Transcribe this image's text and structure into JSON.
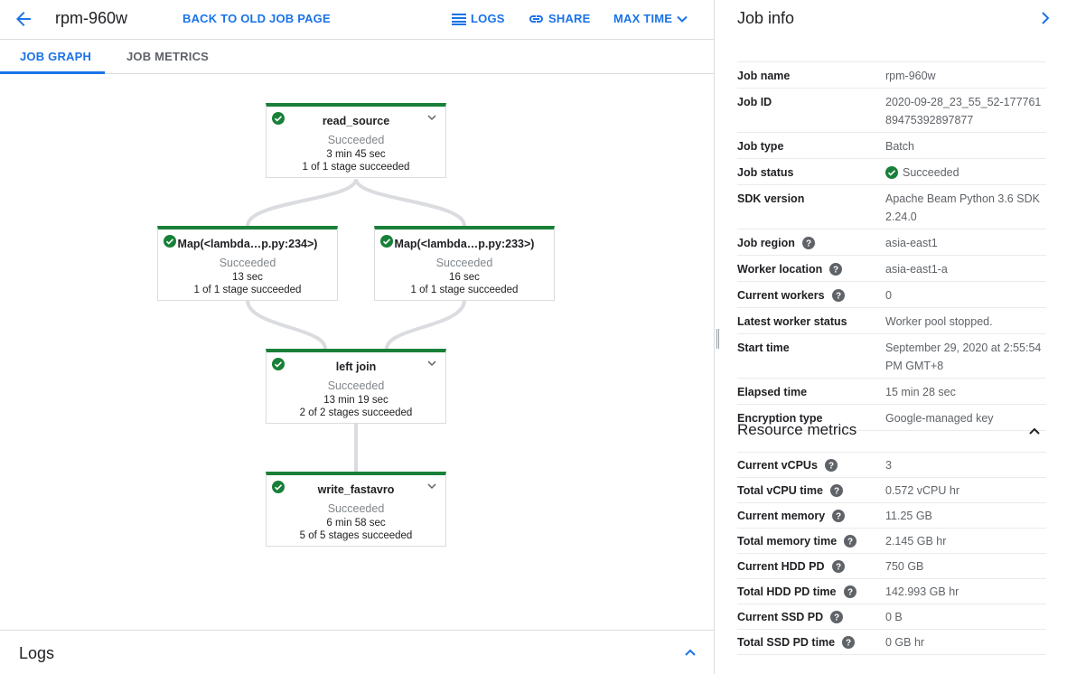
{
  "header": {
    "job_title": "rpm-960w",
    "back_old_label": "BACK TO OLD JOB PAGE",
    "logs_label": "LOGS",
    "share_label": "SHARE",
    "max_time_label": "MAX TIME"
  },
  "tabs": [
    {
      "label": "JOB GRAPH",
      "active": true
    },
    {
      "label": "JOB METRICS",
      "active": false
    }
  ],
  "graph": {
    "nodes": [
      {
        "name": "read_source",
        "status": "Succeeded",
        "duration": "3 min 45 sec",
        "stages": "1 of 1 stage succeeded"
      },
      {
        "name": "Map(<lambda…p.py:234>)",
        "status": "Succeeded",
        "duration": "13 sec",
        "stages": "1 of 1 stage succeeded"
      },
      {
        "name": "Map(<lambda…p.py:233>)",
        "status": "Succeeded",
        "duration": "16 sec",
        "stages": "1 of 1 stage succeeded"
      },
      {
        "name": "left join",
        "status": "Succeeded",
        "duration": "13 min 19 sec",
        "stages": "2 of 2 stages succeeded"
      },
      {
        "name": "write_fastavro",
        "status": "Succeeded",
        "duration": "6 min 58 sec",
        "stages": "5 of 5 stages succeeded"
      }
    ]
  },
  "logs": {
    "title": "Logs"
  },
  "job_info": {
    "title": "Job info",
    "rows": [
      {
        "key": "Job name",
        "value": "rpm-960w"
      },
      {
        "key": "Job ID",
        "value": "2020-09-28_23_55_52-17776189475392897877"
      },
      {
        "key": "Job type",
        "value": "Batch"
      },
      {
        "key": "Job status",
        "value": "Succeeded"
      },
      {
        "key": "SDK version",
        "value": "Apache Beam Python 3.6 SDK 2.24.0"
      },
      {
        "key": "Job region",
        "value": "asia-east1"
      },
      {
        "key": "Worker location",
        "value": "asia-east1-a"
      },
      {
        "key": "Current workers",
        "value": "0"
      },
      {
        "key": "Latest worker status",
        "value": "Worker pool stopped."
      },
      {
        "key": "Start time",
        "value": "September 29, 2020 at 2:55:54 PM GMT+8"
      },
      {
        "key": "Elapsed time",
        "value": "15 min 28 sec"
      },
      {
        "key": "Encryption type",
        "value": "Google-managed key"
      }
    ]
  },
  "resource_metrics": {
    "title": "Resource metrics",
    "rows": [
      {
        "key": "Current vCPUs",
        "value": "3"
      },
      {
        "key": "Total vCPU time",
        "value": "0.572 vCPU hr"
      },
      {
        "key": "Current memory",
        "value": "11.25 GB"
      },
      {
        "key": "Total memory time",
        "value": "2.145 GB hr"
      },
      {
        "key": "Current HDD PD",
        "value": "750 GB"
      },
      {
        "key": "Total HDD PD time",
        "value": "142.993 GB hr"
      },
      {
        "key": "Current SSD PD",
        "value": "0 B"
      },
      {
        "key": "Total SSD PD time",
        "value": "0 GB hr"
      }
    ]
  },
  "colors": {
    "accent": "#1a73e8",
    "success": "#188038",
    "edge": "#dadce0"
  },
  "icons": [
    "arrow-back-icon",
    "list-icon",
    "link-icon",
    "chevron-down-icon",
    "check-circle-icon",
    "help-icon",
    "chevron-right-icon",
    "chevron-up-icon"
  ]
}
